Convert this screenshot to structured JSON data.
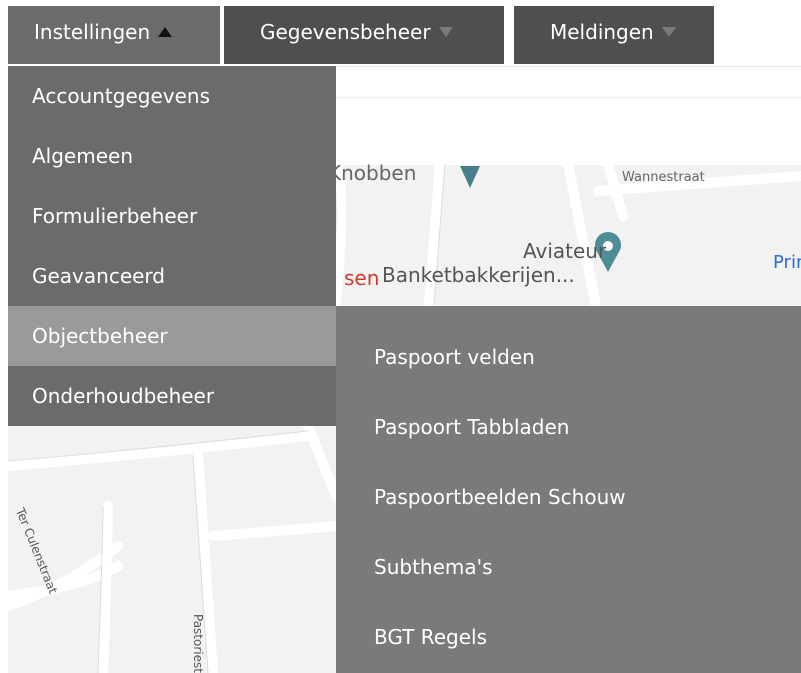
{
  "nav": {
    "instellingen_label": "Instellingen",
    "gegevensbeheer_label": "Gegevensbeheer",
    "meldingen_label": "Meldingen"
  },
  "menu": {
    "items": [
      {
        "label": "Accountgegevens"
      },
      {
        "label": "Algemeen"
      },
      {
        "label": "Formulierbeheer"
      },
      {
        "label": "Geavanceerd"
      },
      {
        "label": "Objectbeheer",
        "active": true
      },
      {
        "label": "Onderhoudbeheer"
      }
    ]
  },
  "submenu": {
    "items": [
      {
        "label": "Paspoort velden"
      },
      {
        "label": "Paspoort Tabbladen"
      },
      {
        "label": "Paspoortbeelden Schouw"
      },
      {
        "label": "Subthema's"
      },
      {
        "label": "BGT Regels"
      }
    ]
  },
  "map": {
    "labels": {
      "knobben": "Knobben",
      "wannestraat": "Wannestraat",
      "aviateur": "Aviateur",
      "banket": "Banketbakkerijen...",
      "printh": "Printh",
      "sen": "sen",
      "culenstraat": "Ter Culenstraat",
      "pastoriestraat": "Pastoriestraat"
    }
  },
  "icons": {
    "nav_open": "caret-up-icon",
    "nav_closed": "caret-down-icon",
    "map_pin": "map-pin-icon"
  },
  "colors": {
    "menu_bg": "#6b6b6b",
    "menu_active": "#9a9a9a",
    "submenu_bg": "#7a7a7a",
    "nav_bg": "#4f4f4f",
    "map_bg": "#f2f2f2"
  }
}
